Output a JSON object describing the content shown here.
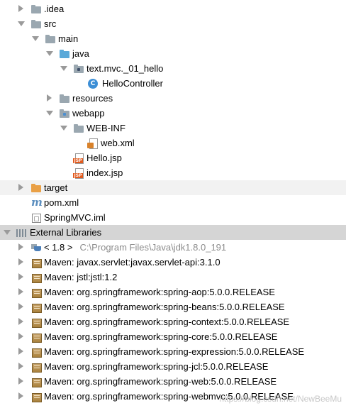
{
  "tree": {
    "idea": ".idea",
    "src": "src",
    "main": "main",
    "java": "java",
    "package": "text.mvc._01_hello",
    "hello_controller": "HelloController",
    "resources": "resources",
    "webapp": "webapp",
    "web_inf": "WEB-INF",
    "web_xml": "web.xml",
    "hello_jsp": "Hello.jsp",
    "index_jsp": "index.jsp",
    "target": "target",
    "pom_xml": "pom.xml",
    "iml": "SpringMVC.iml",
    "external_libraries": "External Libraries",
    "jdk_label": "< 1.8 >",
    "jdk_path": "C:\\Program Files\\Java\\jdk1.8.0_191",
    "libraries": [
      "Maven: javax.servlet:javax.servlet-api:3.1.0",
      "Maven: jstl:jstl:1.2",
      "Maven: org.springframework:spring-aop:5.0.0.RELEASE",
      "Maven: org.springframework:spring-beans:5.0.0.RELEASE",
      "Maven: org.springframework:spring-context:5.0.0.RELEASE",
      "Maven: org.springframework:spring-core:5.0.0.RELEASE",
      "Maven: org.springframework:spring-expression:5.0.0.RELEASE",
      "Maven: org.springframework:spring-jcl:5.0.0.RELEASE",
      "Maven: org.springframework:spring-web:5.0.0.RELEASE",
      "Maven: org.springframework:spring-webmvc:5.0.0.RELEASE"
    ]
  },
  "watermark": "https://blog.csdn.net/NewBeeMu",
  "colors": {
    "section_highlight": "#d5d5d5",
    "row_highlight": "#f2f2f2",
    "path_text": "#8c8c8c"
  }
}
